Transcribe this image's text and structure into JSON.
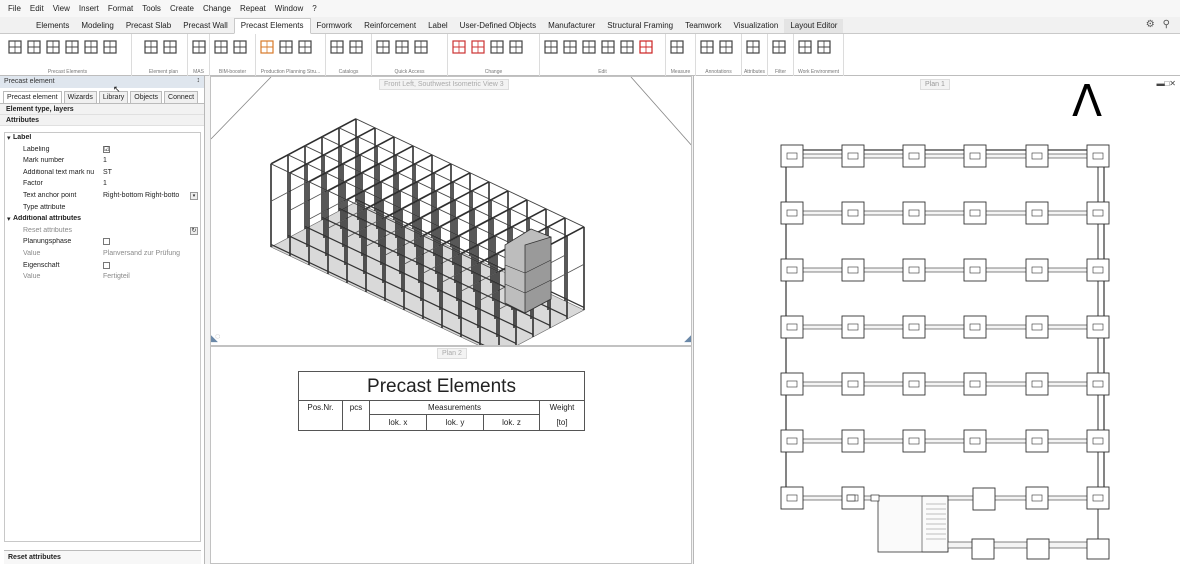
{
  "menu": [
    "File",
    "Edit",
    "View",
    "Insert",
    "Format",
    "Tools",
    "Create",
    "Change",
    "Repeat",
    "Window",
    "?"
  ],
  "tabs": [
    "Elements",
    "Modeling",
    "Precast Slab",
    "Precast Wall",
    "Precast Elements",
    "Formwork",
    "Reinforcement",
    "Label",
    "User-Defined Objects",
    "Manufacturer",
    "Structural Framing",
    "Teamwork",
    "Visualization",
    "Layout Editor"
  ],
  "active_tab": "Precast Elements",
  "ribbon_groups": [
    {
      "label": "Precast Elements"
    },
    {
      "label": "Element plan"
    },
    {
      "label": "MAS"
    },
    {
      "label": "BIM-booster"
    },
    {
      "label": "Production Planning Stru..."
    },
    {
      "label": "Catalogs"
    },
    {
      "label": "Quick Access"
    },
    {
      "label": "Change"
    },
    {
      "label": "Edit"
    },
    {
      "label": "Measure"
    },
    {
      "label": "Annotations"
    },
    {
      "label": "Attributes"
    },
    {
      "label": "Filter"
    },
    {
      "label": "Work Environment"
    }
  ],
  "panel": {
    "title": "Precast element",
    "pin": "↕",
    "tabs": [
      "Precast element",
      "Wizards",
      "Library",
      "Objects",
      "Connect"
    ],
    "sections": [
      "Element type, layers",
      "Attributes"
    ],
    "label_group": "Label",
    "rows": [
      {
        "label": "Labeling",
        "value": "",
        "check": "☑"
      },
      {
        "label": "Mark number",
        "value": "1"
      },
      {
        "label": "Additional text mark nu",
        "value": "ST"
      },
      {
        "label": "Factor",
        "value": "1"
      },
      {
        "label": "Text anchor point",
        "value": "Right-bottom   Right-botto"
      },
      {
        "label": "Type attribute",
        "value": ""
      }
    ],
    "additional_group": "Additional attributes",
    "rows2": [
      {
        "label": "Reset attributes",
        "value": "",
        "gray": true
      },
      {
        "label": "Planungsphase",
        "value": "",
        "check": ""
      },
      {
        "label": "Value",
        "value": "Planversand zur Prüfung",
        "gray": true
      },
      {
        "label": "Eigenschaft",
        "value": "",
        "check": ""
      },
      {
        "label": "Value",
        "value": "Fertigteil",
        "gray": true
      }
    ],
    "bottom": "Reset attributes"
  },
  "views": {
    "view3d_label": "Front Left, Southwest Isometric View 3",
    "plan2_label": "Plan 2",
    "plan1_label": "Plan 1",
    "caret": "Λ",
    "win_ctrl": "▬□✕"
  },
  "precast_table": {
    "title": "Precast Elements",
    "headers": [
      "Pos.Nr.",
      "pcs",
      "Measurements",
      "Weight"
    ],
    "subheaders": [
      "lok. x",
      "lok. y",
      "lok. z",
      "[to]"
    ]
  }
}
